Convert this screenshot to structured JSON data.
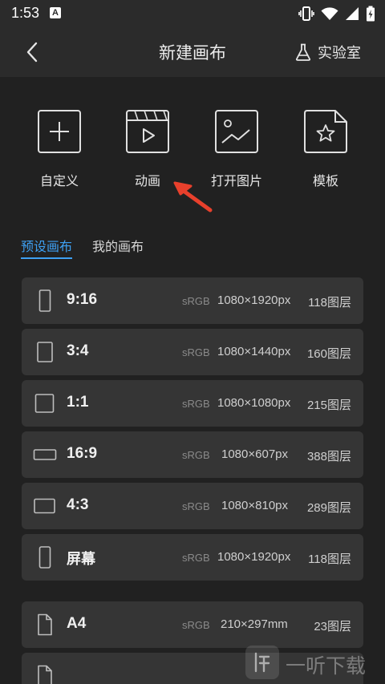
{
  "status": {
    "time": "1:53",
    "notification_letter": "A"
  },
  "header": {
    "title": "新建画布",
    "lab_label": "实验室"
  },
  "quick_actions": [
    {
      "label": "自定义",
      "icon": "plus-icon"
    },
    {
      "label": "动画",
      "icon": "clapperboard-icon"
    },
    {
      "label": "打开图片",
      "icon": "image-icon"
    },
    {
      "label": "模板",
      "icon": "star-document-icon"
    }
  ],
  "tabs": [
    {
      "label": "预设画布",
      "active": true
    },
    {
      "label": "我的画布",
      "active": false
    }
  ],
  "presets": [
    {
      "name": "9:16",
      "color": "sRGB",
      "size": "1080×1920px",
      "layers": "118图层",
      "icon": "portrait-tall-icon"
    },
    {
      "name": "3:4",
      "color": "sRGB",
      "size": "1080×1440px",
      "layers": "160图层",
      "icon": "portrait-icon"
    },
    {
      "name": "1:1",
      "color": "sRGB",
      "size": "1080×1080px",
      "layers": "215图层",
      "icon": "square-icon"
    },
    {
      "name": "16:9",
      "color": "sRGB",
      "size": "1080×607px",
      "layers": "388图层",
      "icon": "landscape-wide-icon"
    },
    {
      "name": "4:3",
      "color": "sRGB",
      "size": "1080×810px",
      "layers": "289图层",
      "icon": "landscape-icon"
    },
    {
      "name": "屏幕",
      "color": "sRGB",
      "size": "1080×1920px",
      "layers": "118图层",
      "icon": "screen-icon"
    },
    {
      "name": "A4",
      "color": "sRGB",
      "size": "210×297mm",
      "layers": "23图层",
      "icon": "document-icon"
    }
  ],
  "watermark": {
    "text": "一听下载"
  },
  "colors": {
    "accent": "#3ea0f2",
    "arrow": "#e8402c"
  }
}
